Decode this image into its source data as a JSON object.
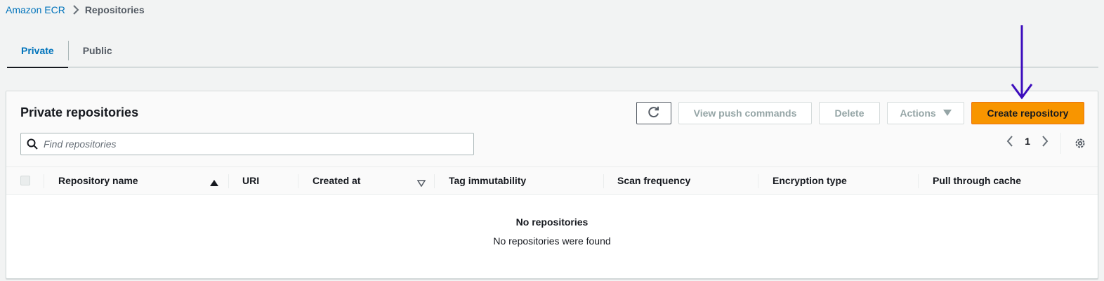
{
  "breadcrumb": {
    "root": "Amazon ECR",
    "current": "Repositories"
  },
  "tabs": [
    {
      "label": "Private",
      "active": true
    },
    {
      "label": "Public",
      "active": false
    }
  ],
  "panel": {
    "title": "Private repositories",
    "buttons": {
      "view_push": "View push commands",
      "delete": "Delete",
      "actions": "Actions",
      "create": "Create repository"
    },
    "search_placeholder": "Find repositories",
    "page": "1"
  },
  "table": {
    "columns": [
      "Repository name",
      "URI",
      "Created at",
      "Tag immutability",
      "Scan frequency",
      "Encryption type",
      "Pull through cache"
    ],
    "empty_title": "No repositories",
    "empty_subtitle": "No repositories were found"
  },
  "colors": {
    "accent": "#0073bb",
    "primary_button": "#f89500",
    "annotation_arrow": "#3d0dbd"
  },
  "icons": [
    "chevron-right-icon",
    "refresh-icon",
    "caret-down-icon",
    "search-icon",
    "chevron-left-icon",
    "settings-icon",
    "sort-ascending-icon",
    "sort-descending-icon",
    "annotation-arrow-icon"
  ]
}
